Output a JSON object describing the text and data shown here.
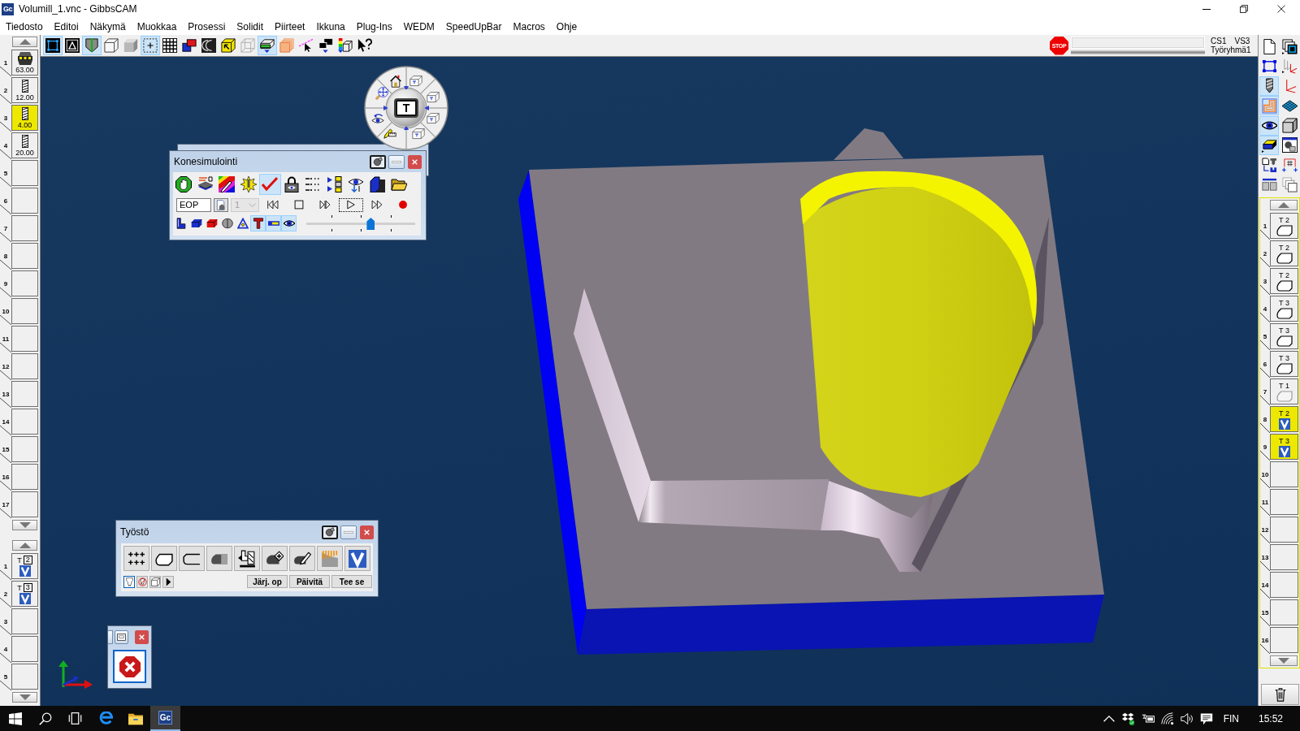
{
  "window": {
    "app_icon": "Gc",
    "title": "Volumill_1.vnc - GibbsCAM"
  },
  "menu": [
    "Tiedosto",
    "Editoi",
    "Näkymä",
    "Muokkaa",
    "Prosessi",
    "Solidit",
    "Piirteet",
    "Ikkuna",
    "Plug-Ins",
    "WEDM",
    "SpeedUpBar",
    "Macros",
    "Ohje"
  ],
  "toolbar": [
    {
      "kind": "frame",
      "pressed": true
    },
    {
      "kind": "text_frame",
      "pressed": false
    },
    {
      "kind": "wedge",
      "pressed": true
    },
    {
      "kind": "cube_outline",
      "pressed": false
    },
    {
      "kind": "cube_solid",
      "pressed": false
    },
    {
      "kind": "dotted_square",
      "pressed": true
    },
    {
      "kind": "grid",
      "pressed": false
    },
    {
      "kind": "blocks",
      "pressed": false
    },
    {
      "kind": "arc",
      "pressed": false
    },
    {
      "kind": "yellow_cube",
      "pressed": false
    },
    {
      "kind": "wire_cube",
      "pressed": false
    },
    {
      "kind": "layered_block",
      "pressed": true
    },
    {
      "kind": "stacked_squares",
      "pressed": false
    },
    {
      "kind": "line_cursor",
      "pressed": false
    },
    {
      "kind": "black_squares",
      "pressed": false
    },
    {
      "kind": "color_scale",
      "pressed": false
    },
    {
      "kind": "help_cursor",
      "pressed": false
    }
  ],
  "status": {
    "stop_sign": "STOP",
    "labels": [
      "CS1",
      "VS3",
      "Työryhmä1"
    ]
  },
  "tool_list": {
    "tools": [
      {
        "number": "1",
        "kind": "face_mill",
        "diameter": "63.00",
        "selected": false
      },
      {
        "number": "2",
        "kind": "end_mill",
        "diameter": "12.00",
        "selected": false
      },
      {
        "number": "3",
        "kind": "end_mill",
        "diameter": "4.00",
        "selected": true
      },
      {
        "number": "4",
        "kind": "end_mill",
        "diameter": "20.00",
        "selected": false
      }
    ],
    "empty_slots": [
      "5",
      "6",
      "7",
      "8",
      "9",
      "10",
      "11",
      "12",
      "13",
      "14",
      "15",
      "16",
      "17"
    ]
  },
  "process_list": {
    "processes": [
      {
        "number": "1",
        "kind": "volumill",
        "prefix": "T",
        "tool": "2"
      },
      {
        "number": "2",
        "kind": "volumill",
        "prefix": "T",
        "tool": "3"
      }
    ],
    "empty_slots": [
      "3",
      "4",
      "5"
    ]
  },
  "side_toolbar": [
    {
      "kind": "page",
      "pressed": false
    },
    {
      "kind": "stacked_windows",
      "pressed": false
    },
    {
      "kind": "frame_blue",
      "pressed": false
    },
    {
      "kind": "axes_gray",
      "pressed": false
    },
    {
      "kind": "end_mill_big",
      "pressed": true
    },
    {
      "kind": "axes_red",
      "pressed": false
    },
    {
      "kind": "toolpath",
      "pressed": true
    },
    {
      "kind": "surface_grid",
      "pressed": false
    },
    {
      "kind": "eye",
      "pressed": true
    },
    {
      "kind": "cube_gray",
      "pressed": false
    },
    {
      "kind": "solid_face",
      "pressed": true
    },
    {
      "kind": "sphere_window",
      "pressed": false
    },
    {
      "kind": "doc_mill",
      "pressed": false
    },
    {
      "kind": "hash_bracket",
      "pressed": false
    },
    {
      "kind": "split_bar",
      "pressed": false
    },
    {
      "kind": "stacked_gray",
      "pressed": false
    }
  ],
  "operations": {
    "items": [
      {
        "number": "1",
        "kind": "contour",
        "label": "T 2",
        "selected": false,
        "disabled": false
      },
      {
        "number": "2",
        "kind": "contour",
        "label": "T 2",
        "selected": false,
        "disabled": false
      },
      {
        "number": "3",
        "kind": "contour",
        "label": "T 2",
        "selected": false,
        "disabled": false
      },
      {
        "number": "4",
        "kind": "contour",
        "label": "T 3",
        "selected": false,
        "disabled": false
      },
      {
        "number": "5",
        "kind": "contour",
        "label": "T 3",
        "selected": false,
        "disabled": false
      },
      {
        "number": "6",
        "kind": "contour",
        "label": "T 3",
        "selected": false,
        "disabled": false
      },
      {
        "number": "7",
        "kind": "contour",
        "label": "T 1",
        "selected": false,
        "disabled": true
      },
      {
        "number": "8",
        "kind": "volumill",
        "label": "T 2",
        "selected": true,
        "disabled": false
      },
      {
        "number": "9",
        "kind": "volumill",
        "label": "T 3",
        "selected": true,
        "disabled": false
      }
    ],
    "empty_slots": [
      "10",
      "11",
      "12",
      "13",
      "14",
      "15",
      "16"
    ]
  },
  "nav_wheel": {
    "center_label": "T"
  },
  "simulation": {
    "title": "Konesimulointi",
    "tools": [
      {
        "kind": "hand_stop",
        "pressed": false
      },
      {
        "kind": "layers",
        "pressed": false
      },
      {
        "kind": "rainbow_pencil",
        "pressed": false
      },
      {
        "kind": "burst",
        "pressed": false
      },
      {
        "kind": "check",
        "pressed": true
      },
      {
        "kind": "lock",
        "pressed": false
      },
      {
        "kind": "xyz_list",
        "pressed": false
      },
      {
        "kind": "step_grid",
        "pressed": false
      },
      {
        "kind": "eye_arrows",
        "pressed": false
      },
      {
        "kind": "block_dark",
        "pressed": false
      },
      {
        "kind": "folder",
        "pressed": false
      }
    ],
    "position": "EOP",
    "step": {
      "value": "1",
      "disabled": true
    },
    "playback": [
      {
        "kind": "rewind",
        "focused": false
      },
      {
        "kind": "stop",
        "focused": false
      },
      {
        "kind": "step",
        "focused": false
      },
      {
        "kind": "play",
        "focused": true
      },
      {
        "kind": "fast_forward",
        "focused": false
      },
      {
        "kind": "record",
        "focused": false
      }
    ],
    "display": [
      {
        "kind": "l_block",
        "pressed": false
      },
      {
        "kind": "box_blue",
        "pressed": false
      },
      {
        "kind": "box_red",
        "pressed": false
      },
      {
        "kind": "cylinder",
        "pressed": false
      },
      {
        "kind": "triangle",
        "pressed": false
      },
      {
        "kind": "t_bar",
        "pressed": true
      },
      {
        "kind": "bar",
        "pressed": true
      },
      {
        "kind": "eye",
        "pressed": true
      }
    ],
    "speed": {
      "level": 0.6
    }
  },
  "machining": {
    "title": "Työstö",
    "operations": [
      {
        "kind": "points"
      },
      {
        "kind": "contour"
      },
      {
        "kind": "contour_open"
      },
      {
        "kind": "profile"
      },
      {
        "kind": "fixture"
      },
      {
        "kind": "profile_plus"
      },
      {
        "kind": "profile_pencil"
      },
      {
        "kind": "surface_passes"
      },
      {
        "kind": "volumill"
      }
    ],
    "options": [
      {
        "kind": "mill_tool",
        "pressed": true
      },
      {
        "kind": "no_tool",
        "pressed": false
      },
      {
        "kind": "box_small",
        "pressed": false
      },
      {
        "kind": "arrow_right",
        "pressed": false
      }
    ],
    "buttons": [
      "Järj. op",
      "Päivitä",
      "Tee se"
    ]
  },
  "taskbar": {
    "apps": [
      {
        "kind": "browser",
        "active": false
      },
      {
        "kind": "folder",
        "active": false
      },
      {
        "kind": "app",
        "label": "Gc",
        "active": true
      }
    ],
    "language": "FIN",
    "time": "15:52"
  }
}
